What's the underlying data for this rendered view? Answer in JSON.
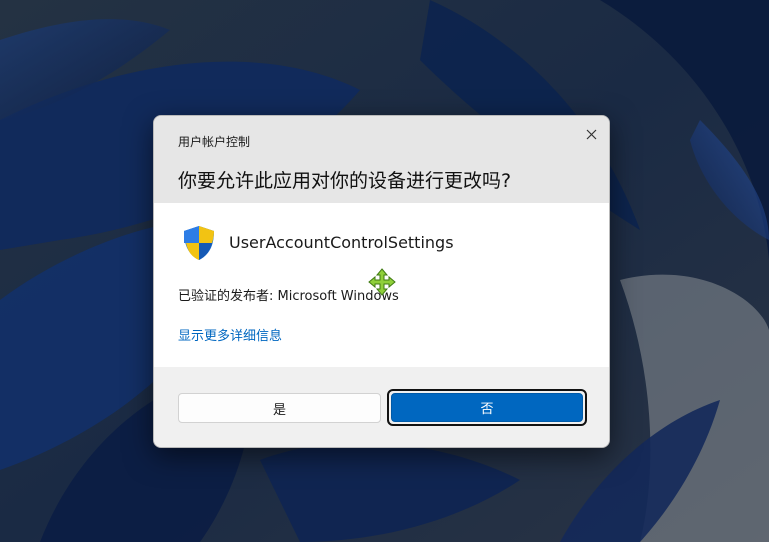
{
  "desktop": {
    "wallpaper": "windows-11-bloom-dark-blue"
  },
  "dialog": {
    "caption": "用户帐户控制",
    "question": "你要允许此应用对你的设备进行更改吗?",
    "close_icon": "close-icon",
    "app_icon": "uac-shield-icon",
    "app_name": "UserAccountControlSettings",
    "publisher": "已验证的发布者: Microsoft Windows",
    "details_link": "显示更多详细信息",
    "yes_label": "是",
    "no_label": "否"
  },
  "cursor": {
    "icon": "move-cursor-icon"
  },
  "colors": {
    "accent": "#0067c0",
    "link": "#0067c0",
    "header_bg": "#e6e6e6",
    "body_bg": "#ffffff"
  }
}
